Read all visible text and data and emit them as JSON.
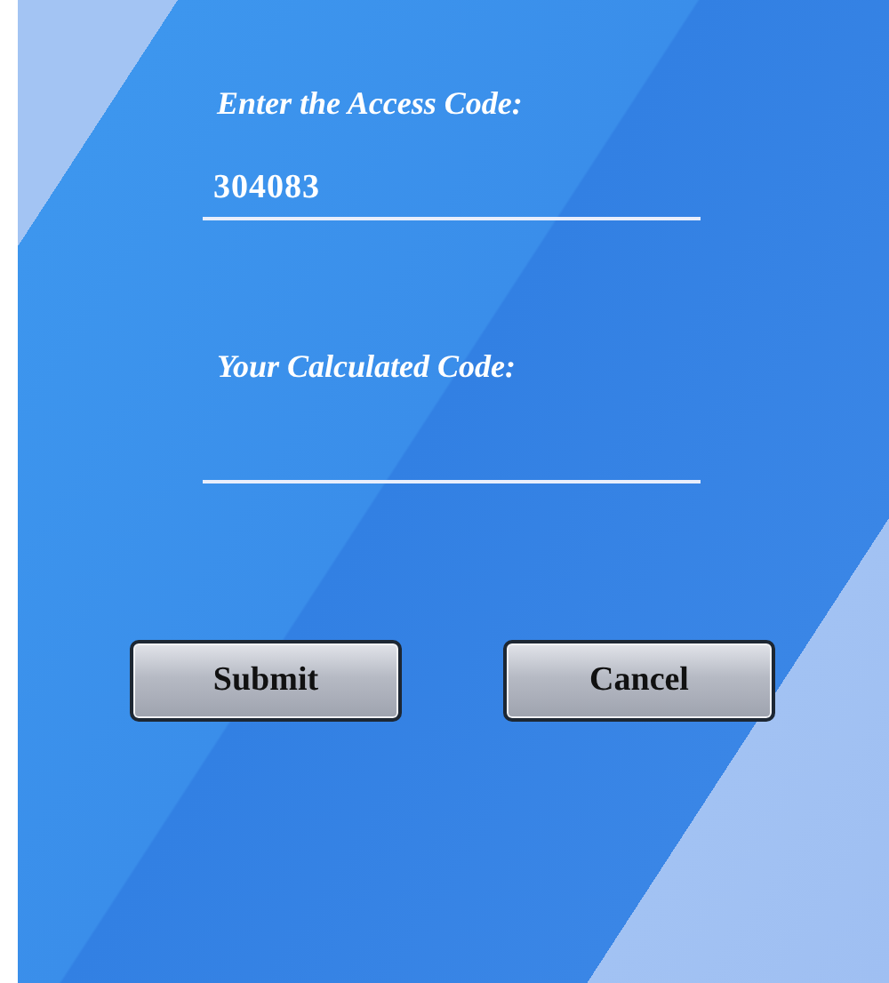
{
  "fields": [
    {
      "label": "Enter the Access Code:",
      "value": "304083"
    },
    {
      "label": "Your Calculated Code:"
    }
  ],
  "buttons": [
    "Submit",
    "Cancel"
  ]
}
